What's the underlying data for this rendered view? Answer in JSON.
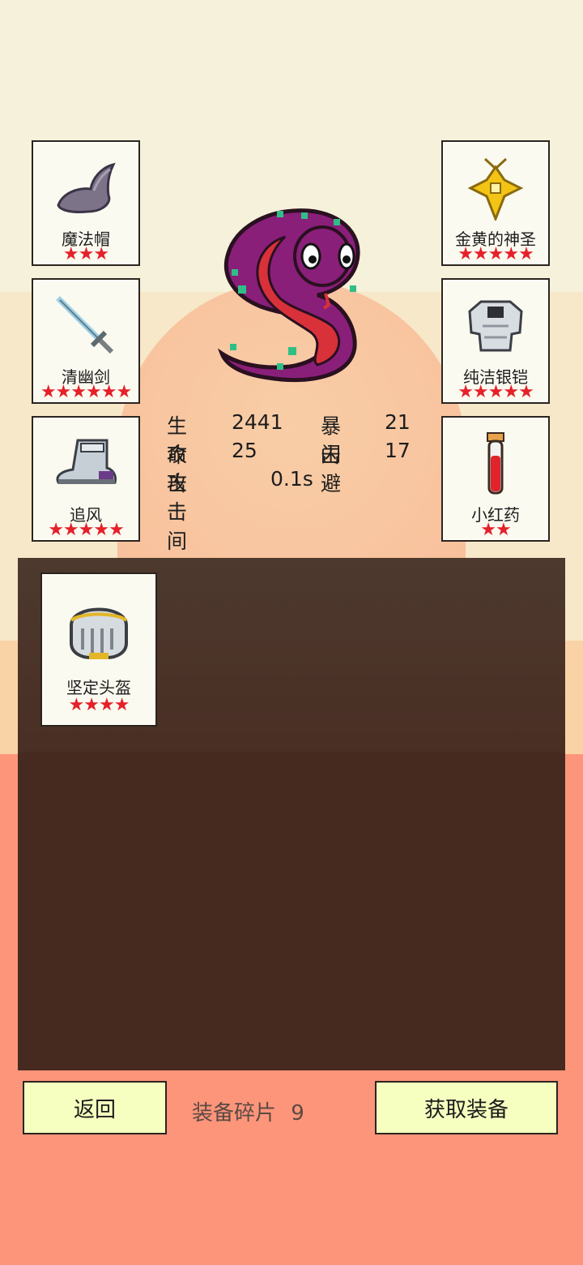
{
  "hero": {
    "name_icon": "cobra-icon",
    "stats": {
      "hp_label": "生命",
      "hp_value": "2441",
      "crit_label": "暴击",
      "crit_value": "21",
      "atk_label": "攻击",
      "atk_value": "25",
      "dodge_label": "闪避",
      "dodge_value": "17",
      "interval_label": "攻击间隔",
      "interval_value": "0.1s"
    }
  },
  "equipped": {
    "left": [
      {
        "name": "魔法帽",
        "stars": "★★★",
        "icon": "wizard-hat-icon"
      },
      {
        "name": "清幽剑",
        "stars": "★★★★★★",
        "icon": "sword-icon"
      },
      {
        "name": "追风",
        "stars": "★★★★★",
        "icon": "boot-icon"
      }
    ],
    "right": [
      {
        "name": "金黄的神圣",
        "stars": "★★★★★",
        "icon": "golden-cross-icon"
      },
      {
        "name": "纯洁银铠",
        "stars": "★★★★★",
        "icon": "silver-armor-icon"
      },
      {
        "name": "小红药",
        "stars": "★★",
        "icon": "red-potion-icon"
      }
    ]
  },
  "inventory": [
    {
      "name": "坚定头盔",
      "stars": "★★★★",
      "icon": "helmet-icon"
    }
  ],
  "footer": {
    "back_label": "返回",
    "fragments_label": "装备碎片",
    "fragments_value": "9",
    "get_label": "获取装备"
  },
  "colors": {
    "star": "#e5202a",
    "button": "#f6ffbf",
    "panel": "#46291f"
  }
}
